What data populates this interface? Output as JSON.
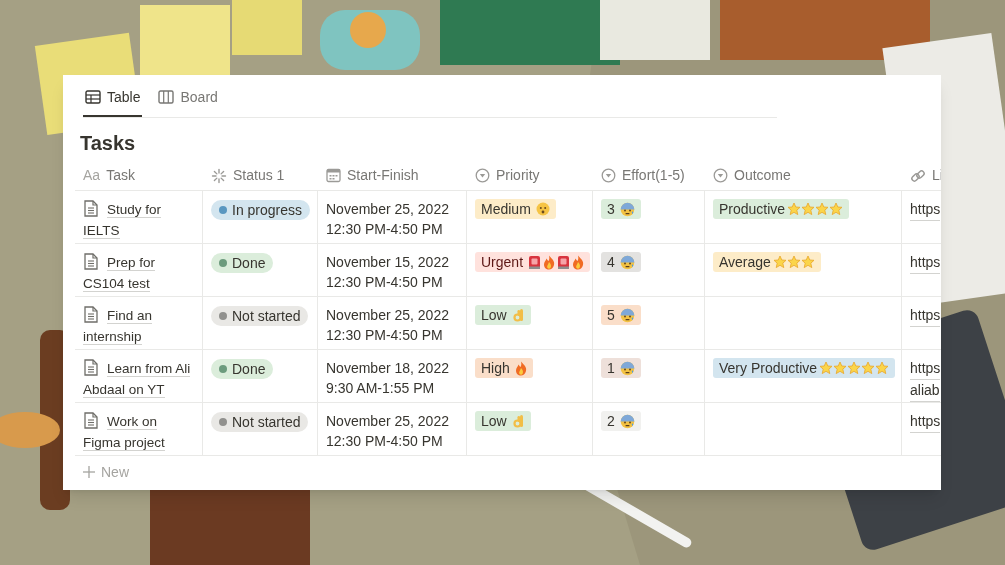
{
  "tabs": [
    {
      "label": "Table",
      "kind": "table",
      "selected": true
    },
    {
      "label": "Board",
      "kind": "board",
      "selected": false
    }
  ],
  "title": "Tasks",
  "columns": [
    {
      "label": "Task",
      "prefix": "Aa",
      "kind": "text"
    },
    {
      "label": "Status 1",
      "kind": "status"
    },
    {
      "label": "Start-Finish",
      "kind": "date"
    },
    {
      "label": "Priority",
      "kind": "select"
    },
    {
      "label": "Effort(1-5)",
      "kind": "select"
    },
    {
      "label": "Outcome",
      "kind": "select"
    },
    {
      "label": "Li",
      "kind": "url"
    }
  ],
  "rows": [
    {
      "task": "Study for IELTS",
      "status": {
        "label": "In progress",
        "color": "#5a97c0"
      },
      "date": "November 25, 2022",
      "time": "12:30 PM-4:50 PM",
      "priority": {
        "label": "Medium",
        "kind": "medium",
        "color": "#fdecc8"
      },
      "effort": {
        "label": "3",
        "color": "#dbeddb"
      },
      "outcome": {
        "label": "Productive",
        "stars": 4,
        "color": "#dbeddb"
      },
      "link": [
        "https"
      ]
    },
    {
      "task": "Prep for CS104 test",
      "status": {
        "label": "Done",
        "color": "#6c9b7d"
      },
      "date": "November 15, 2022",
      "time": "12:30 PM-4:50 PM",
      "priority": {
        "label": "Urgent",
        "kind": "urgent",
        "color": "#ffe2dd"
      },
      "effort": {
        "label": "4",
        "color": "#e3e2e0"
      },
      "outcome": {
        "label": "Average",
        "stars": 3,
        "color": "#fdecc8"
      },
      "link": [
        "https"
      ]
    },
    {
      "task": "Find an internship",
      "status": {
        "label": "Not started",
        "color": "#91918e"
      },
      "date": "November 25, 2022",
      "time": "12:30 PM-4:50 PM",
      "priority": {
        "label": "Low",
        "kind": "low",
        "color": "#dbeddb"
      },
      "effort": {
        "label": "5",
        "color": "#fadec9"
      },
      "link": [
        "https"
      ]
    },
    {
      "task": "Learn from Ali Abdaal on YT",
      "status": {
        "label": "Done",
        "color": "#6c9b7d"
      },
      "date": "November 18, 2022",
      "time": "9:30 AM-1:55 PM",
      "priority": {
        "label": "High",
        "kind": "high",
        "color": "#fadec9"
      },
      "effort": {
        "label": "1",
        "color": "#eee0da"
      },
      "outcome": {
        "label": "Very Productive",
        "stars": 5,
        "color": "#d3e5ef"
      },
      "link": [
        "https",
        "aliab"
      ]
    },
    {
      "task": "Work on Figma project",
      "status": {
        "label": "Not started",
        "color": "#91918e"
      },
      "date": "November 25, 2022",
      "time": "12:30 PM-4:50 PM",
      "priority": {
        "label": "Low",
        "kind": "low",
        "color": "#dbeddb"
      },
      "effort": {
        "label": "2",
        "color": "#f1f1ef"
      },
      "link": [
        "https"
      ]
    }
  ],
  "new_row": {
    "label": "New"
  }
}
